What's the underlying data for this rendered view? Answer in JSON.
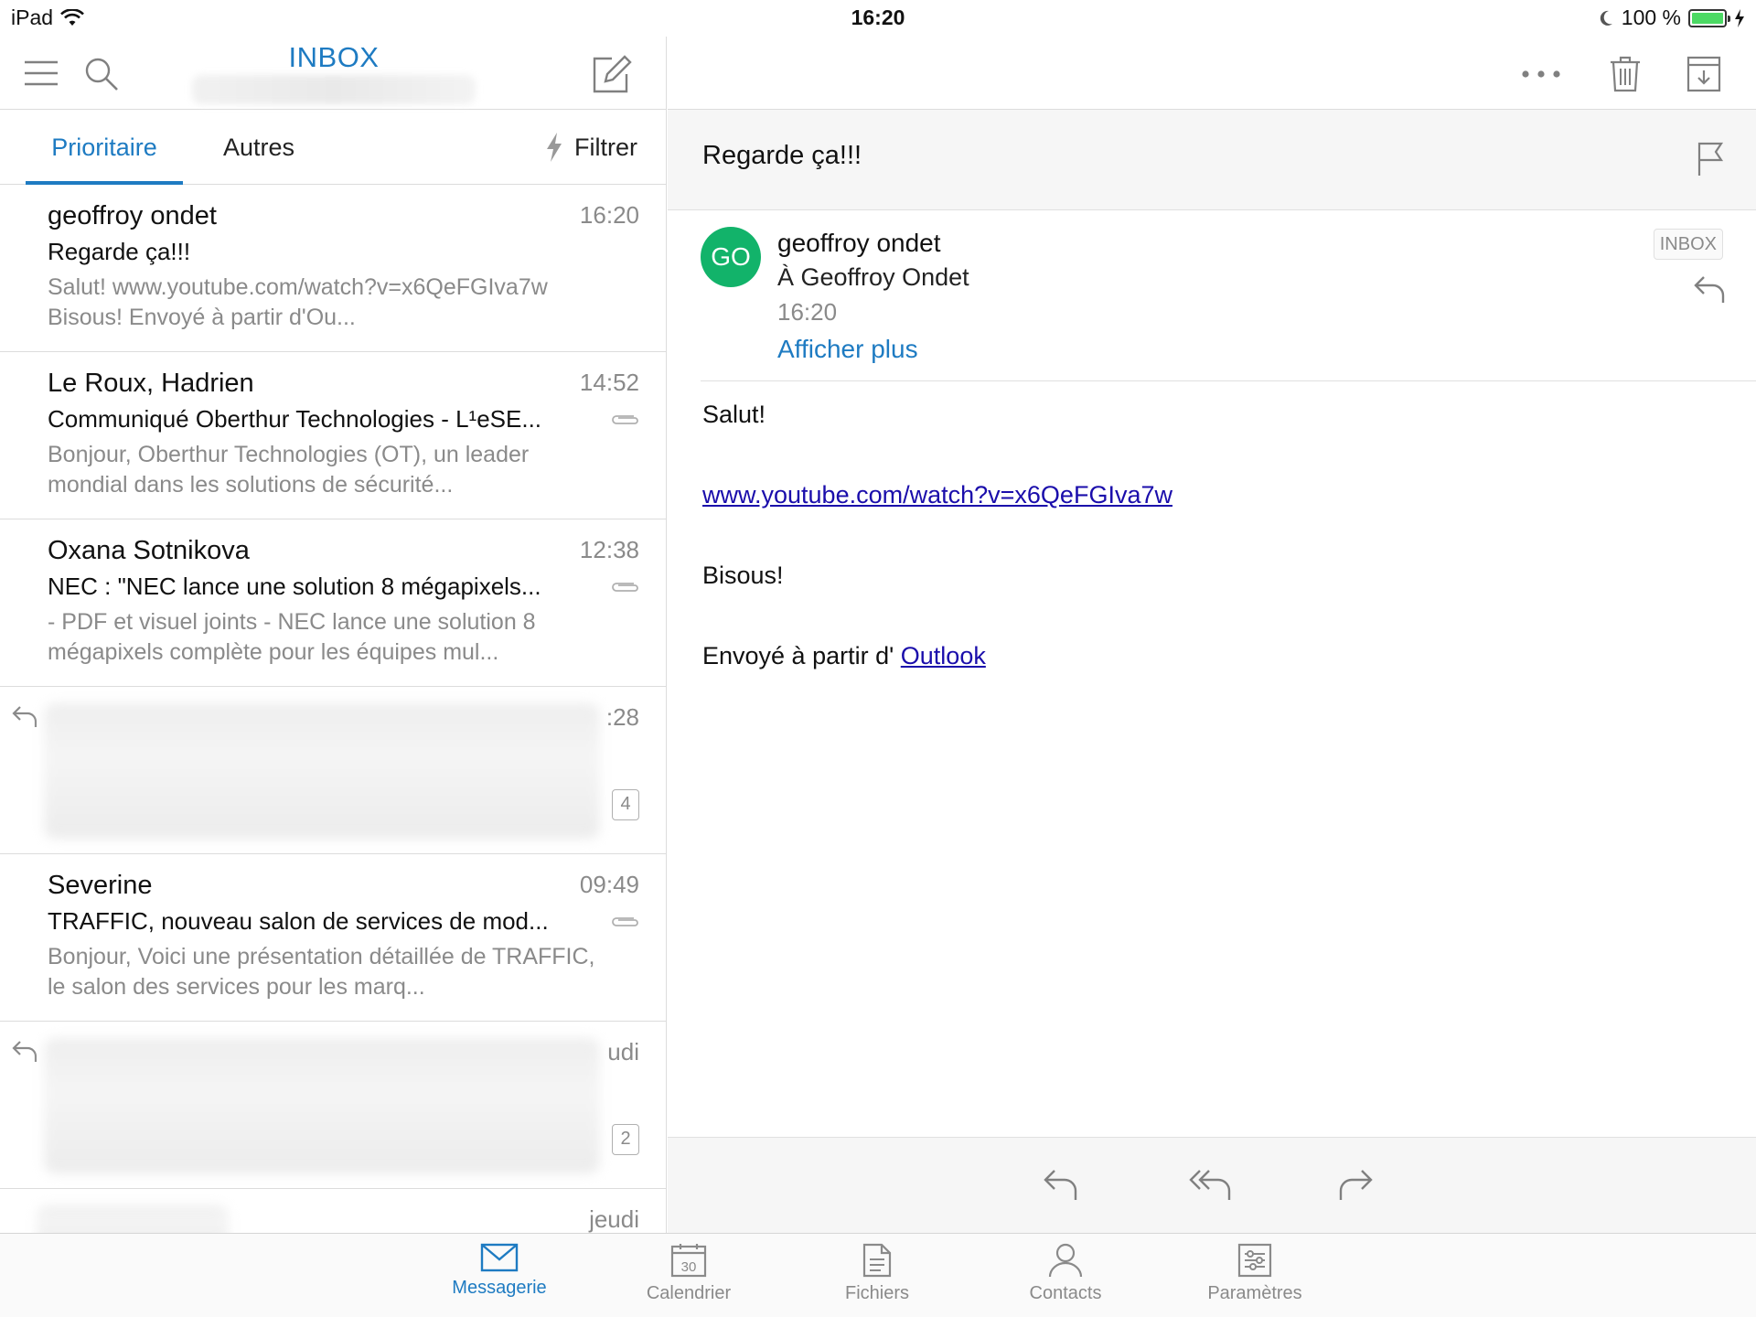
{
  "status_bar": {
    "device": "iPad",
    "time": "16:20",
    "battery": "100 %"
  },
  "left_header": {
    "title": "INBOX"
  },
  "tabs": {
    "priority": "Prioritaire",
    "others": "Autres",
    "filter": "Filtrer"
  },
  "messages": [
    {
      "sender": "geoffroy ondet",
      "time": "16:20",
      "subject": "Regarde ça!!!",
      "preview": "Salut! www.youtube.com/watch?v=x6QeFGIva7w Bisous! Envoyé à partir d'Ou..."
    },
    {
      "sender": "Le Roux, Hadrien",
      "time": "14:52",
      "subject": "Communiqué Oberthur Technologies - L¹eSE...",
      "preview": "Bonjour, Oberthur Technologies (OT), un leader mondial dans les solutions de sécurité..."
    },
    {
      "sender": "Oxana Sotnikova",
      "time": "12:38",
      "subject": "NEC : \"NEC lance une solution 8 mégapixels...",
      "preview": "- PDF et visuel joints - NEC lance une solution 8 mégapixels complète pour les équipes mul..."
    },
    {
      "time": ":28",
      "count": "4"
    },
    {
      "sender": "Severine",
      "time": "09:49",
      "subject": "TRAFFIC, nouveau salon de services de mod...",
      "preview": "Bonjour, Voici une présentation détaillée de TRAFFIC, le salon des services pour les marq..."
    },
    {
      "time": "udi",
      "count": "2"
    },
    {
      "time": "jeudi"
    }
  ],
  "reading_pane": {
    "subject": "Regarde ça!!!",
    "avatar_initials": "GO",
    "from": "geoffroy ondet",
    "to": "À Geoffroy Ondet",
    "time": "16:20",
    "show_more": "Afficher plus",
    "folder_badge": "INBOX",
    "body": {
      "greeting": "Salut!",
      "link": "www.youtube.com/watch?v=x6QeFGIva7w",
      "closing": "Bisous!",
      "signature_prefix": "Envoyé à partir d'",
      "signature_link": "Outlook"
    }
  },
  "nav": {
    "mail": "Messagerie",
    "calendar": "Calendrier",
    "calendar_day": "30",
    "files": "Fichiers",
    "contacts": "Contacts",
    "settings": "Paramètres"
  },
  "colors": {
    "accent": "#1e7bc2",
    "avatar": "#12b36a",
    "battery": "#4cd964"
  }
}
